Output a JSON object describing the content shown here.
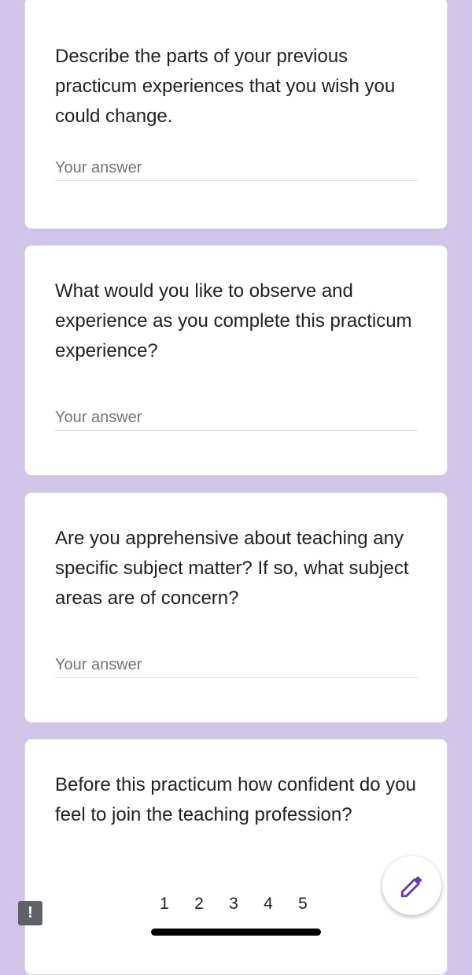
{
  "questions": [
    {
      "text": "Describe the parts of your previous practicum experiences that you wish you could change.",
      "placeholder": "Your answer"
    },
    {
      "text": "What would you like to observe and experience as you complete this practicum experience?",
      "placeholder": "Your answer"
    },
    {
      "text": "Are you apprehensive about teaching any specific subject matter? If so, what subject areas are of concern?",
      "placeholder": "Your answer"
    },
    {
      "text": "Before this practicum how confident do you feel to join the teaching profession?"
    }
  ],
  "pagination": {
    "pages": [
      "1",
      "2",
      "3",
      "4",
      "5"
    ]
  },
  "feedback_button": {
    "label": "!"
  },
  "icons": {
    "fab": "pencil-icon",
    "feedback": "exclamation-icon"
  },
  "colors": {
    "background": "#d1c4e9",
    "card": "#ffffff",
    "accent": "#673ab7"
  }
}
